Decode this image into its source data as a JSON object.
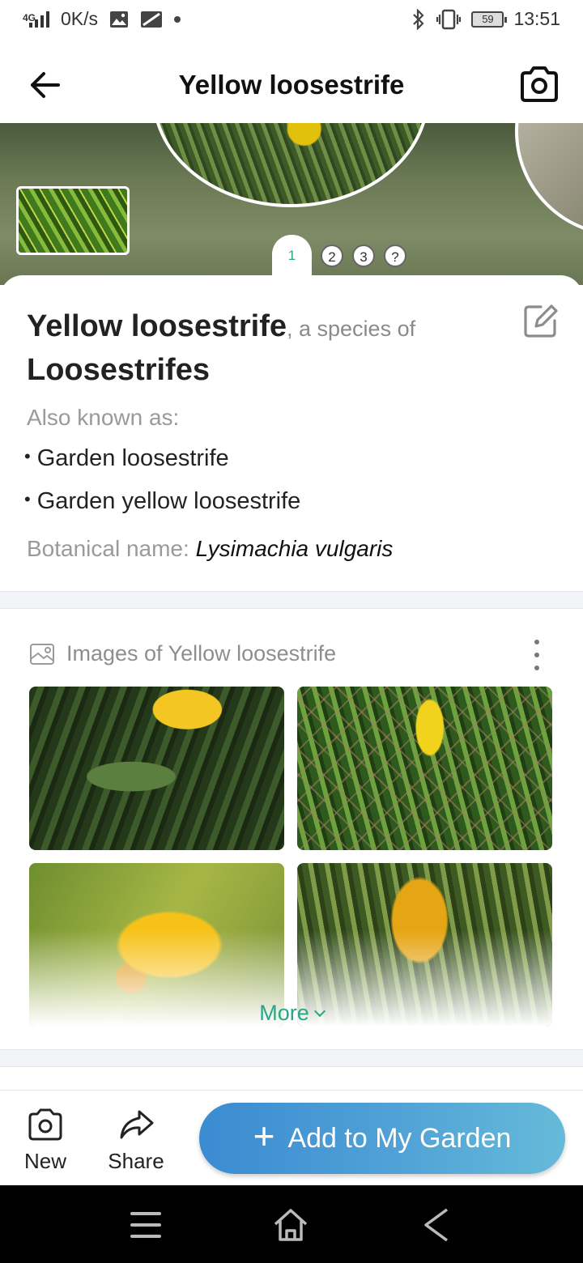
{
  "status_bar": {
    "network": "4G",
    "speed": "0K/s",
    "battery": "59",
    "time": "13:51"
  },
  "app_bar": {
    "title": "Yellow loosestrife"
  },
  "hero": {
    "pages": [
      "1",
      "2",
      "3",
      "?"
    ],
    "active_page": "1"
  },
  "species": {
    "name": "Yellow loosestrife",
    "of_text": ", a species of",
    "genus": "Loosestrifes",
    "aka_label": "Also known as:",
    "aka": [
      "Garden loosestrife",
      "Garden yellow loosestrife"
    ],
    "botanical_label": "Botanical name: ",
    "botanical_name": "Lysimachia vulgaris"
  },
  "images": {
    "title": "Images of Yellow loosestrife",
    "more_label": "More"
  },
  "bottom_bar": {
    "new_label": "New",
    "share_label": "Share",
    "add_label": "Add to My Garden"
  },
  "colors": {
    "accent_green": "#2aa58a",
    "button_blue_start": "#3b8bd1",
    "button_blue_end": "#66bad8"
  }
}
